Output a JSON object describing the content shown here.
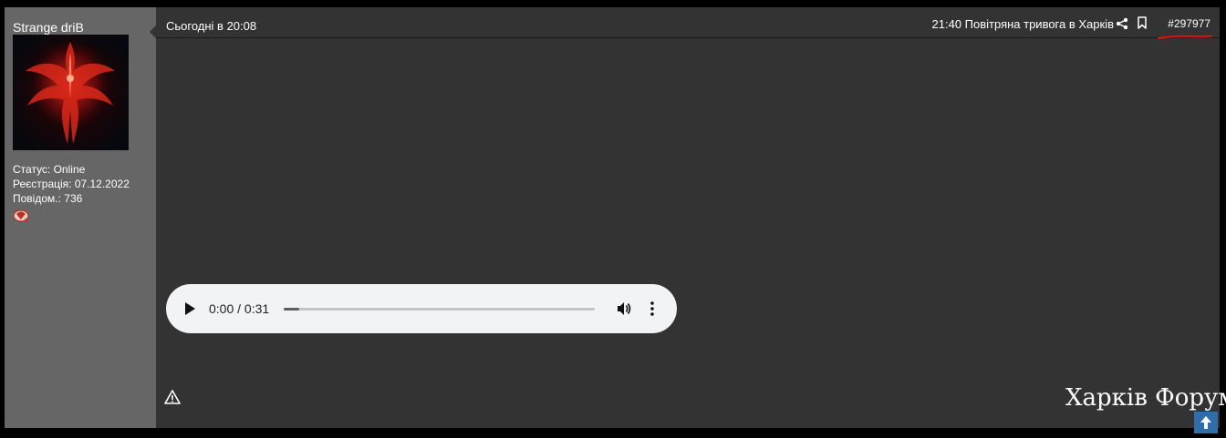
{
  "user": {
    "name": "Strange driB",
    "status": "Статус: Online",
    "registration": "Реєстрація: 07.12.2022",
    "posts": "Повідом.: 736"
  },
  "post": {
    "date": "Сьогодні в 20:08",
    "title": "21:40 Повітряна тривога в Харків",
    "number": "#297977"
  },
  "audio": {
    "time": "0:00 / 0:31",
    "progress_fraction": 0.05
  },
  "watermark": "Харків Форум",
  "icons": [
    "share-icon",
    "bookmark-icon",
    "play-icon",
    "volume-icon",
    "more-vert-icon",
    "warning-icon",
    "award-icon",
    "arrow-up-icon"
  ]
}
